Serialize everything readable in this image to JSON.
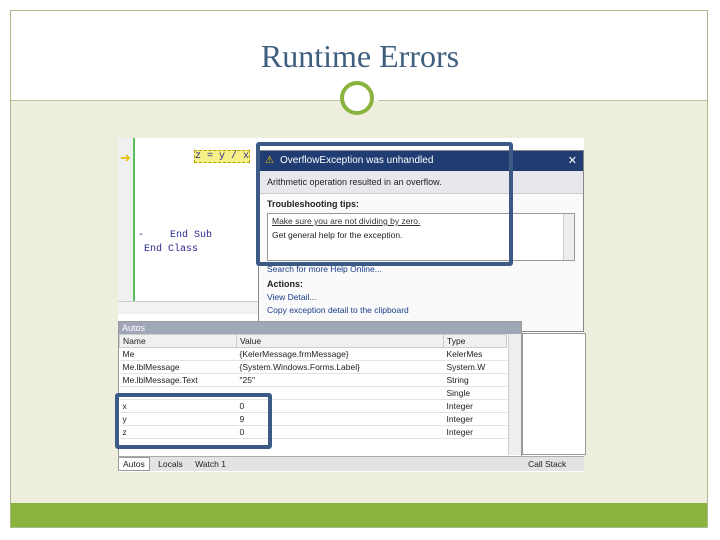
{
  "slide": {
    "title": "Runtime Errors"
  },
  "editor": {
    "statement": "z = y / x",
    "end_sub": "End Sub",
    "end_class": "End Class",
    "collapse": "-"
  },
  "dialog": {
    "title": "OverflowException was unhandled",
    "message": "Arithmetic operation resulted in an overflow.",
    "tips_label": "Troubleshooting tips:",
    "tips": [
      "Make sure you are not dividing by zero.",
      "Get general help for the exception."
    ],
    "search_link": "Search for more Help Online...",
    "actions_label": "Actions:",
    "actions": [
      "View Detail...",
      "Copy exception detail to the clipboard"
    ]
  },
  "autos": {
    "title": "Autos",
    "columns": [
      "Name",
      "Value",
      "Type"
    ],
    "rows": [
      {
        "name": "Me",
        "value": "{KelerMessage.frmMessage}",
        "type": "KelerMes"
      },
      {
        "name": "Me.lblMessage",
        "value": "{System.Windows.Forms.Label}",
        "type": "System.W"
      },
      {
        "name": "Me.lblMessage.Text",
        "value": "\"25\"",
        "type": "String"
      },
      {
        "name": "",
        "value": "",
        "type": "Single"
      },
      {
        "name": "x",
        "value": "0",
        "type": "Integer"
      },
      {
        "name": "y",
        "value": "9",
        "type": "Integer"
      },
      {
        "name": "z",
        "value": "0",
        "type": "Integer"
      }
    ]
  },
  "tabs": [
    "Autos",
    "Locals",
    "Watch 1"
  ],
  "call_stack_tab": "Call Stack"
}
